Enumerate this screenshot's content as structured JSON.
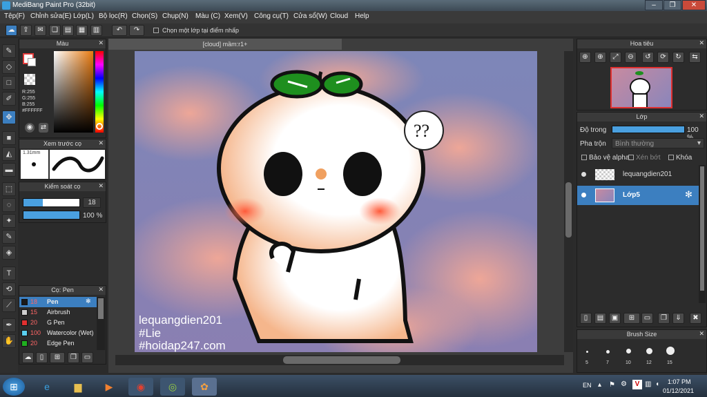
{
  "app": {
    "title": "MediBang Paint Pro (32bit)"
  },
  "menu": [
    "Tệp(F)",
    "Chỉnh sửa(E)",
    "Lớp(L)",
    "Bộ lọc(R)",
    "Chọn(S)",
    "Chụp(N)",
    "Màu (C)",
    "Xem(V)",
    "Công cụ(T)",
    "Cửa sổ(W)",
    "Cloud",
    "Help"
  ],
  "toolbar": {
    "select_layer_label": "Chọn một lớp tại điểm nhấp"
  },
  "color_panel": {
    "title": "Màu",
    "r": "R:255",
    "g": "G:255",
    "b": "B:255",
    "hex": "#FFFFFF",
    "fg": "#ffffff",
    "bg": "#e23b3b"
  },
  "brush_preview": {
    "title": "Xem trước cọ",
    "size": "1.31mm"
  },
  "brush_control": {
    "title": "Kiểm soát cọ",
    "size_value": "18",
    "opacity_value": "100 %",
    "size_fraction": 0.35,
    "opacity_fraction": 1.0
  },
  "brush_list": {
    "title": "Cọ: Pen",
    "items": [
      {
        "size": "18",
        "name": "Pen",
        "color": "#1a1a1a"
      },
      {
        "size": "15",
        "name": "Airbrush",
        "color": "#cfcfcf"
      },
      {
        "size": "20",
        "name": "G Pen",
        "color": "#e03030"
      },
      {
        "size": "100",
        "name": "Watercolor (Wet)",
        "color": "#5ad0f0"
      },
      {
        "size": "20",
        "name": "Edge Pen",
        "color": "#20b020"
      }
    ]
  },
  "document": {
    "tab": "[cloud] mầm:r1+"
  },
  "artwork": {
    "line1": "lequangdien201",
    "line2": "#Lie",
    "line3": "#hoidap247.com",
    "bubble": "??"
  },
  "navigator": {
    "title": "Hoa tiêu"
  },
  "layers": {
    "title": "Lớp",
    "opacity_label": "Độ trong",
    "opacity_value": "100 %",
    "blend_label": "Pha trộn",
    "blend_value": "Bình thường",
    "protect_alpha": "Bảo vệ alpha",
    "clip": "Xén bớt",
    "lock": "Khóa",
    "items": [
      {
        "name": "lequangdien201"
      },
      {
        "name": "Lớp5"
      }
    ]
  },
  "brush_size": {
    "title": "Brush Size",
    "sizes": [
      "5",
      "7",
      "10",
      "12",
      "15"
    ]
  },
  "taskbar": {
    "lang": "EN",
    "time": "1:07 PM",
    "date": "01/12/2021"
  }
}
